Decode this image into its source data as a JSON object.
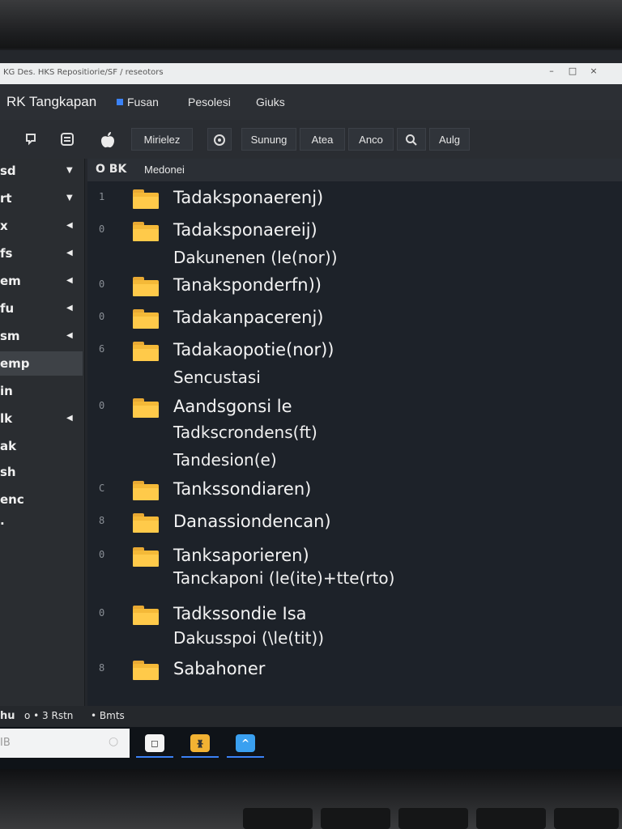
{
  "window": {
    "title": "KG Des. HKS Repositiorie/SF / reseotors",
    "controls": [
      "–",
      "□",
      "×"
    ]
  },
  "menubar": {
    "app_name": "RK Tangkapan",
    "items": [
      "Fusan",
      "Pesolesi",
      "Giuks"
    ]
  },
  "toolbar": {
    "icons": [
      "search-icon",
      "grid-icon",
      "apple-icon"
    ],
    "buttons": [
      "Mirielez",
      "Sunung",
      "Atea",
      "Anco",
      "Aulg"
    ]
  },
  "sidebar": {
    "items": [
      {
        "label": "sd",
        "arrow": "▼"
      },
      {
        "label": "rt",
        "arrow": "▼"
      },
      {
        "label": "x",
        "arrow": "◀"
      },
      {
        "label": "fs",
        "arrow": "◀"
      },
      {
        "label": "em",
        "arrow": "◀"
      },
      {
        "label": "fu",
        "arrow": "◀"
      },
      {
        "label": "sm",
        "arrow": "◀"
      },
      {
        "label": "emp",
        "arrow": ""
      },
      {
        "label": "in",
        "arrow": ""
      },
      {
        "label": "lk",
        "arrow": "◀"
      },
      {
        "label": "ak",
        "arrow": ""
      },
      {
        "label": "sh",
        "arrow": ""
      },
      {
        "label": "enc",
        "arrow": ""
      },
      {
        "label": "·",
        "arrow": ""
      }
    ]
  },
  "pathbar": {
    "prefix": "O BK",
    "name": "Medonei"
  },
  "files": [
    {
      "num": "1",
      "name": "Tadaksponaerenj)",
      "sub": []
    },
    {
      "num": "0",
      "name": "Tadaksponaereij)",
      "sub": [
        "Dakunenen (le(nor))"
      ]
    },
    {
      "num": "0",
      "name": "Tanaksponderfn))",
      "sub": []
    },
    {
      "num": "0",
      "name": "Tadakanpacerenj)",
      "sub": []
    },
    {
      "num": "6",
      "name": "Tadakaopotie(nor))",
      "sub": [
        "Sencustasi"
      ]
    },
    {
      "num": "0",
      "name": "Aandsgonsi le",
      "sub": [
        "Tadkscrondens(ft)",
        "Tandesion(e)"
      ]
    },
    {
      "num": "C",
      "name": "Tankssondiaren)",
      "sub": []
    },
    {
      "num": "8",
      "name": "Danassiondencan)",
      "sub": []
    },
    {
      "num": "0",
      "name": "Tanksaporieren)",
      "sub": [
        "Tanckaponi (le(ite)+tte(rto)"
      ]
    },
    {
      "num": "0",
      "name": "Tadkssondie Isa",
      "sub": [
        "Dakusspoi (\\le(tit))"
      ]
    },
    {
      "num": "8",
      "name": "Sabahoner",
      "sub": []
    }
  ],
  "statusbar": {
    "left": "hu",
    "count": "o • 3 Rstn",
    "right": "• Bmts"
  },
  "taskbar": {
    "search_placeholder": "IB",
    "apps": [
      {
        "name": "finder-app-icon",
        "glyph": "◻",
        "color": "#f4f4f4"
      },
      {
        "name": "notes-app-icon",
        "glyph": "ᚕ",
        "color": "#f2b233"
      },
      {
        "name": "store-app-icon",
        "glyph": "^",
        "color": "#3aa0f0"
      }
    ]
  }
}
